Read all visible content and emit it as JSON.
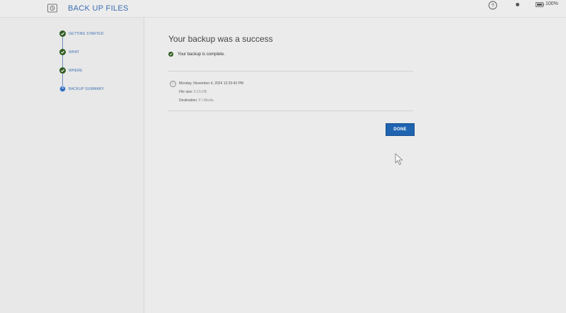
{
  "header": {
    "app_icon": "backup-drive-icon",
    "title": "BACK UP FILES",
    "help_icon": "help-circle-icon",
    "battery_icon": "battery-icon",
    "battery_level": "100%"
  },
  "sidebar": {
    "steps": [
      {
        "label": "GETTING STARTED",
        "state": "done"
      },
      {
        "label": "WHAT",
        "state": "done"
      },
      {
        "label": "WHERE",
        "state": "done"
      },
      {
        "label": "BACKUP SUMMARY",
        "state": "current",
        "number": "4"
      }
    ]
  },
  "main": {
    "title": "Your backup was a success",
    "status_text": "Your backup is complete.",
    "datetime": "Monday, November 4, 2024 12:20:43 PM",
    "file_size_label": "File size:",
    "file_size_value": "5.15 KB",
    "destination_label": "Destination:",
    "destination_value": "F:\\ Media",
    "done_label": "DONE"
  },
  "colors": {
    "accent": "#1f64b0",
    "success": "#2f5b1f",
    "background": "#ebebeb"
  }
}
